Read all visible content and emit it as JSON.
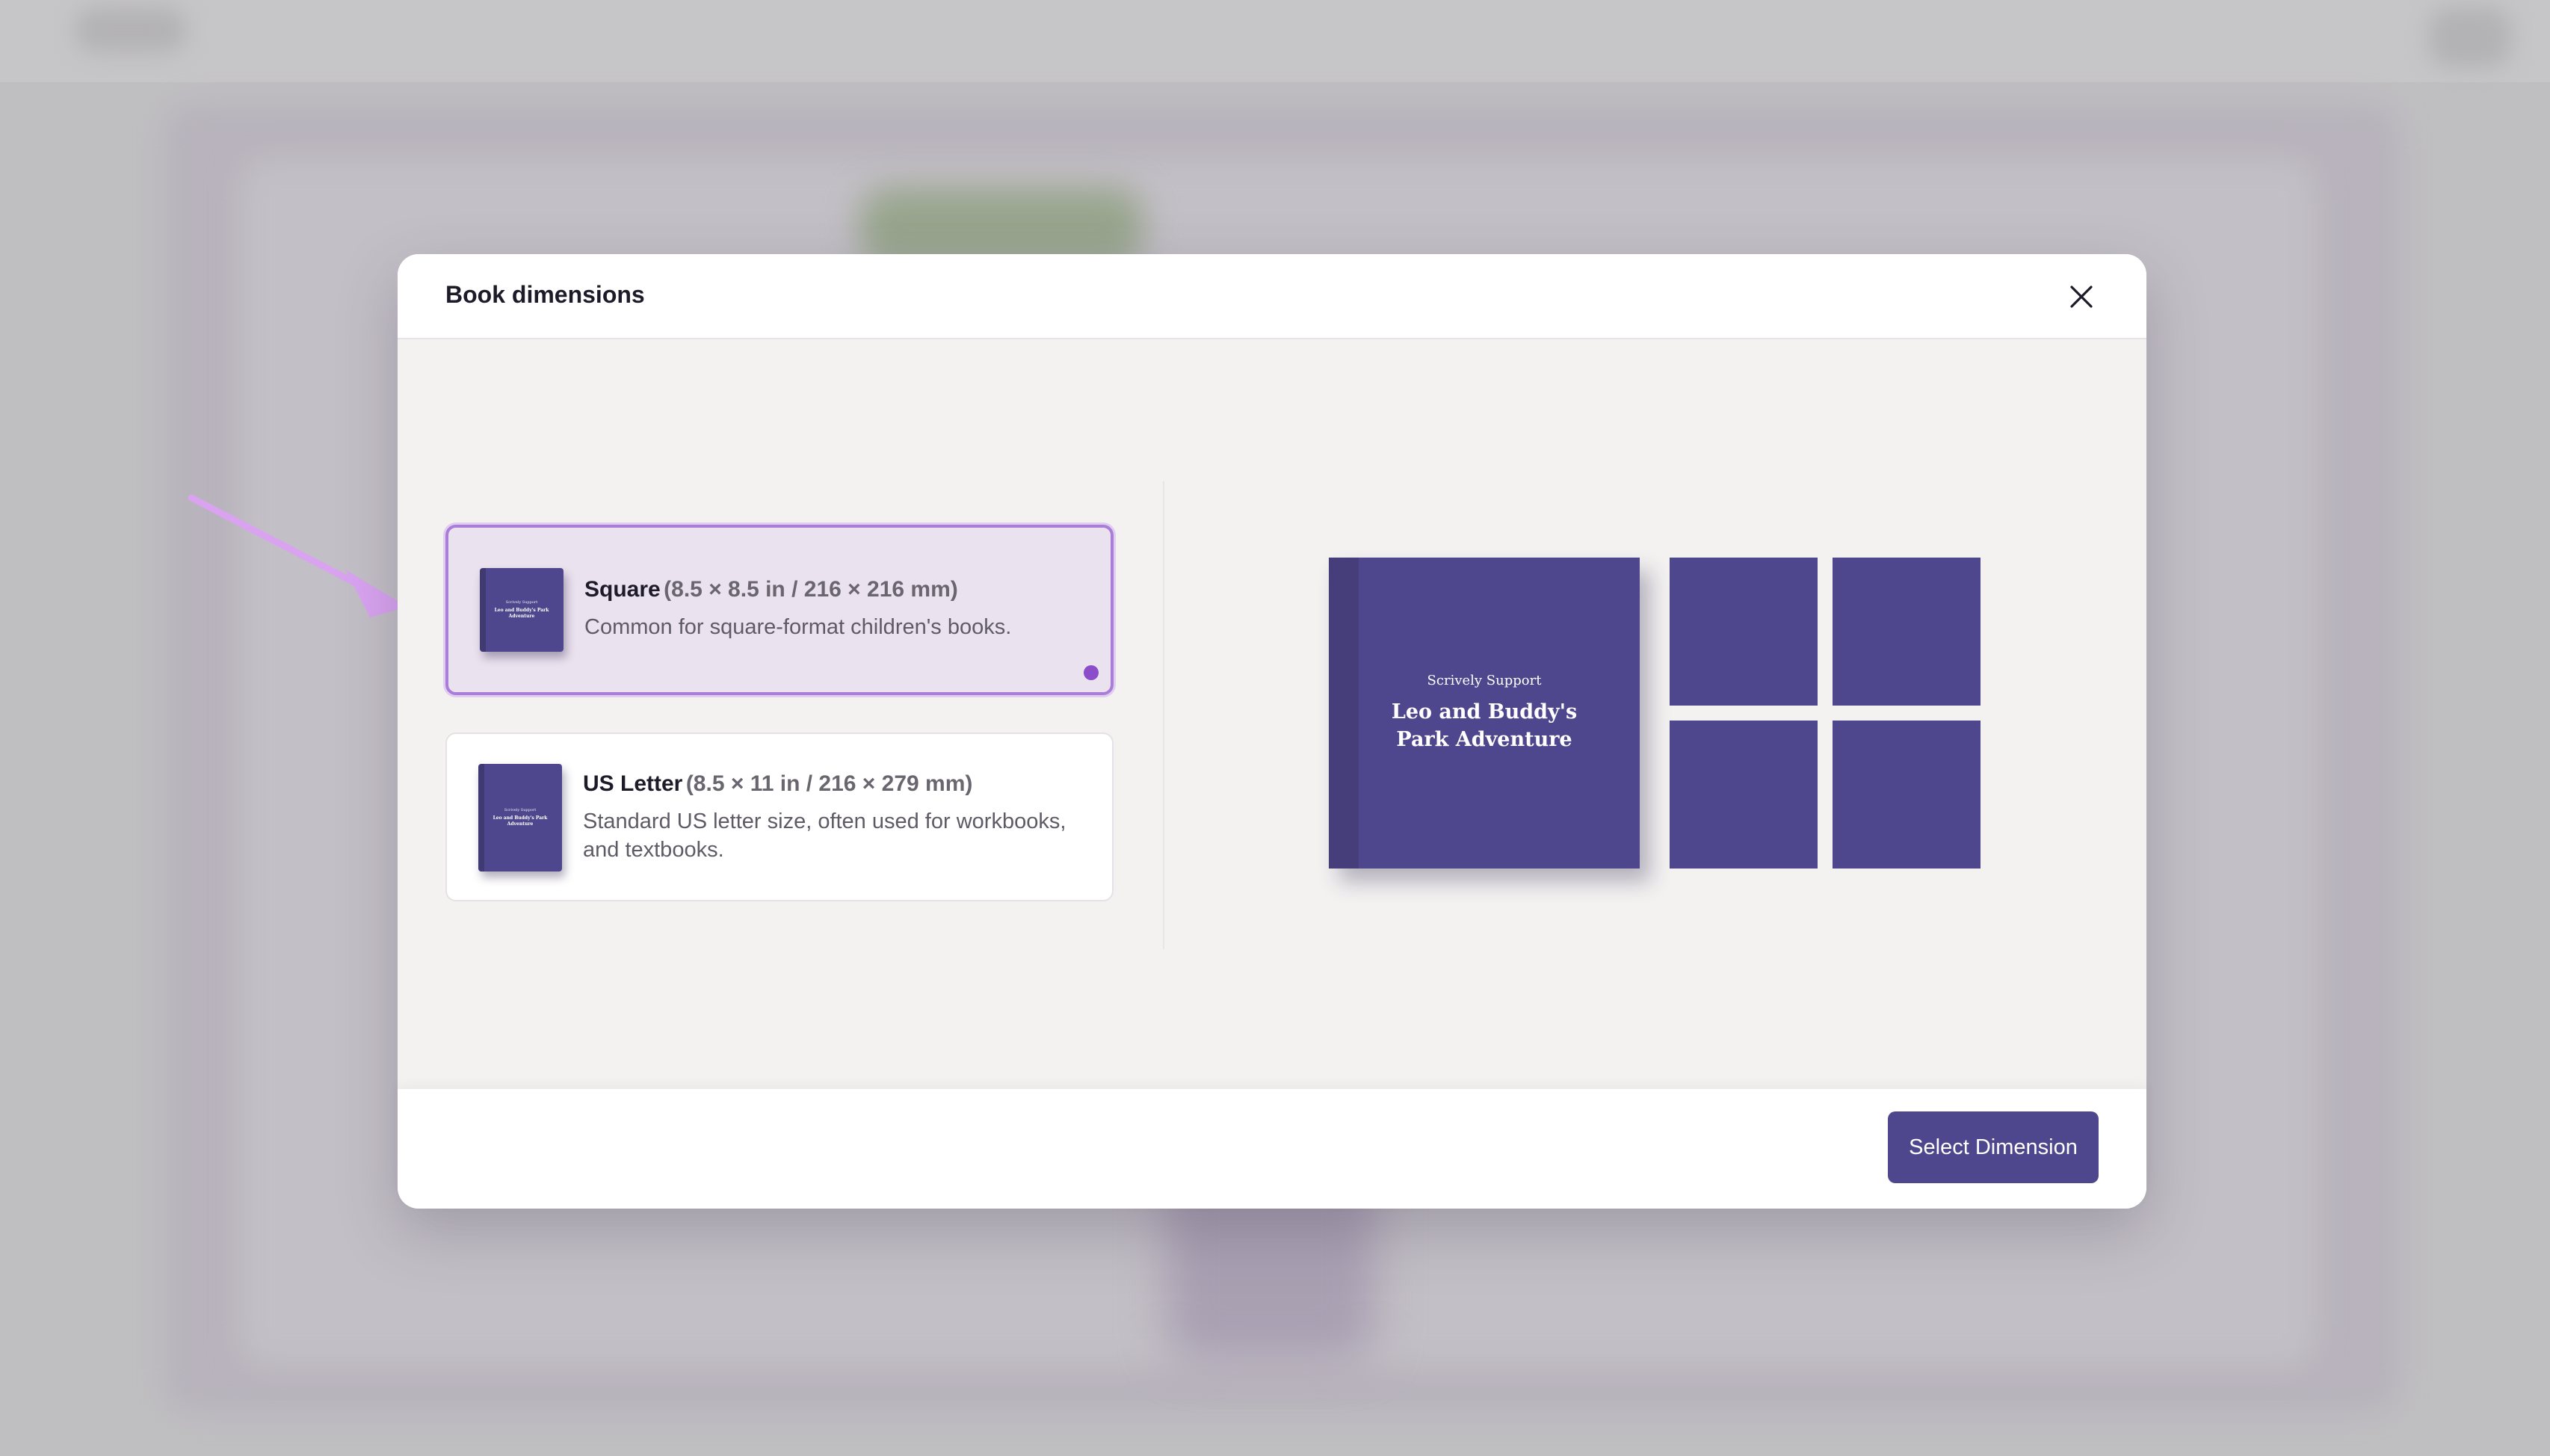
{
  "modal": {
    "title": "Book dimensions",
    "close_icon": "close-icon"
  },
  "options": [
    {
      "name": "Square",
      "dims": "(8.5 × 8.5 in / 216 × 216 mm)",
      "description": "Common for square-format children's books.",
      "selected": true,
      "thumb_subtitle": "Scrively Support",
      "thumb_title": "Leo and Buddy's Park Adventure"
    },
    {
      "name": "US Letter",
      "dims": "(8.5 × 11 in / 216 × 279 mm)",
      "description": "Standard US letter size, often used for workbooks, and textbooks.",
      "selected": false,
      "thumb_subtitle": "Scrively Support",
      "thumb_title": "Leo and Buddy's Park Adventure"
    }
  ],
  "preview": {
    "cover_subtitle": "Scrively Support",
    "cover_title": "Leo and Buddy's Park Adventure"
  },
  "footer": {
    "select_label": "Select Dimension"
  },
  "colors": {
    "accent": "#4f478d",
    "selected_border": "#a87ed9",
    "selected_bg": "#ebe2ef",
    "arrow": "#d9a3f0"
  }
}
